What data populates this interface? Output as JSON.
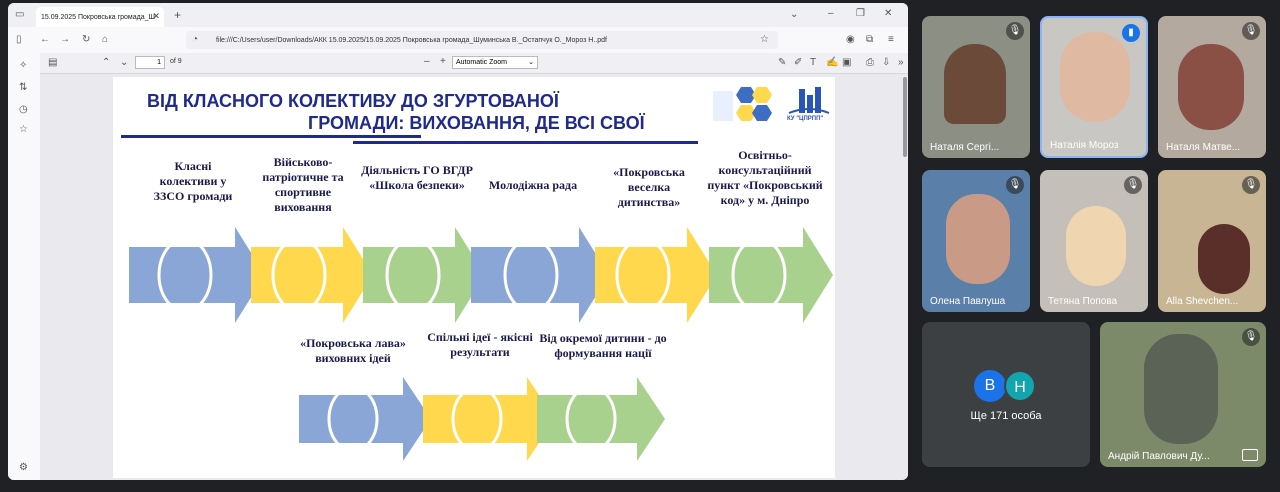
{
  "browser": {
    "tab_title": "15.09.2025 Покровська громада_Ш",
    "url": "file:///C:/Users/user/Downloads/АКК 15.09.2025/15.09.2025 Покровська громада_Шуминська В._Остапчук О._Мороз Н..pdf",
    "page_current": "1",
    "page_total": "of 9",
    "zoom": "Automatic Zoom"
  },
  "slide": {
    "title_line1": "ВІД КЛАСНОГО КОЛЕКТИВУ ДО ЗГУРТОВАНОЇ",
    "title_line2": "ГРОМАДИ: ВИХОВАННЯ, ДЕ ВСІ СВОЇ",
    "labels_top": [
      "Класні колективи у ЗЗСО громади",
      "Військово-патріотичне та спортивне виховання",
      "Діяльність ГО ВГДР «Школа безпеки»",
      "Молодіжна рада",
      "«Покровська веселка дитинства»",
      "Освітньо-консультаційний пункт «Покровський код» у м. Дніпро"
    ],
    "labels_bottom": [
      "«Покровська лава» виховних ідей",
      "Спільні ідеї - якісні результати",
      "Від окремої дитини - до формування нації"
    ],
    "logo_text": "КУ \"ЦПРПП\""
  },
  "meet": {
    "participants": [
      {
        "name": "Наталя Сергі..."
      },
      {
        "name": "Наталія Мороз"
      },
      {
        "name": "Наталя Матве..."
      },
      {
        "name": "Олена Павлуша"
      },
      {
        "name": "Тетяна Попова"
      },
      {
        "name": "Alla Shevchen..."
      },
      {
        "name": "Андрій Павлович Ду..."
      }
    ],
    "others_label": "Ще 171 особа",
    "avatar_a": "В",
    "avatar_b": "Н"
  },
  "colors": {
    "blue": "#8aa6d6",
    "yellow": "#ffd84d",
    "green": "#a9d18e",
    "title": "#1f2a8c"
  }
}
